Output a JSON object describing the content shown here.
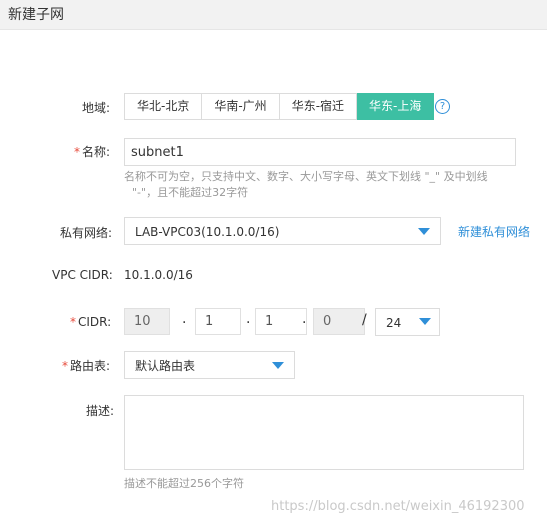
{
  "window": {
    "title": "新建子网"
  },
  "region": {
    "label": "地域:",
    "options": [
      "华北-北京",
      "华南-广州",
      "华东-宿迁",
      "华东-上海"
    ],
    "selected": "华东-上海",
    "help_icon": "question-circle-icon"
  },
  "name": {
    "required_mark": "*",
    "label": "名称:",
    "value": "subnet1",
    "hint_line1": "名称不可为空，只支持中文、数字、大小写字母、英文下划线 \"_\" 及中划线",
    "hint_line2": "\"-\"，且不能超过32字符"
  },
  "vpc": {
    "label": "私有网络:",
    "selected": "LAB-VPC03(10.1.0.0/16)",
    "create_link": "新建私有网络"
  },
  "vpc_cidr": {
    "label": "VPC CIDR:",
    "value": "10.1.0.0/16"
  },
  "cidr": {
    "required_mark": "*",
    "label": "CIDR:",
    "octets": [
      "10",
      "1",
      "1",
      "0"
    ],
    "slash": "/",
    "mask": "24"
  },
  "route_table": {
    "required_mark": "*",
    "label": "路由表:",
    "selected": "默认路由表"
  },
  "description": {
    "label": "描述:",
    "value": "",
    "hint": "描述不能超过256个字符"
  },
  "watermark": "https://blog.csdn.net/weixin_46192300",
  "colors": {
    "accent": "#3dbfa3",
    "link": "#2f8fd8",
    "required": "#e74c3c"
  }
}
